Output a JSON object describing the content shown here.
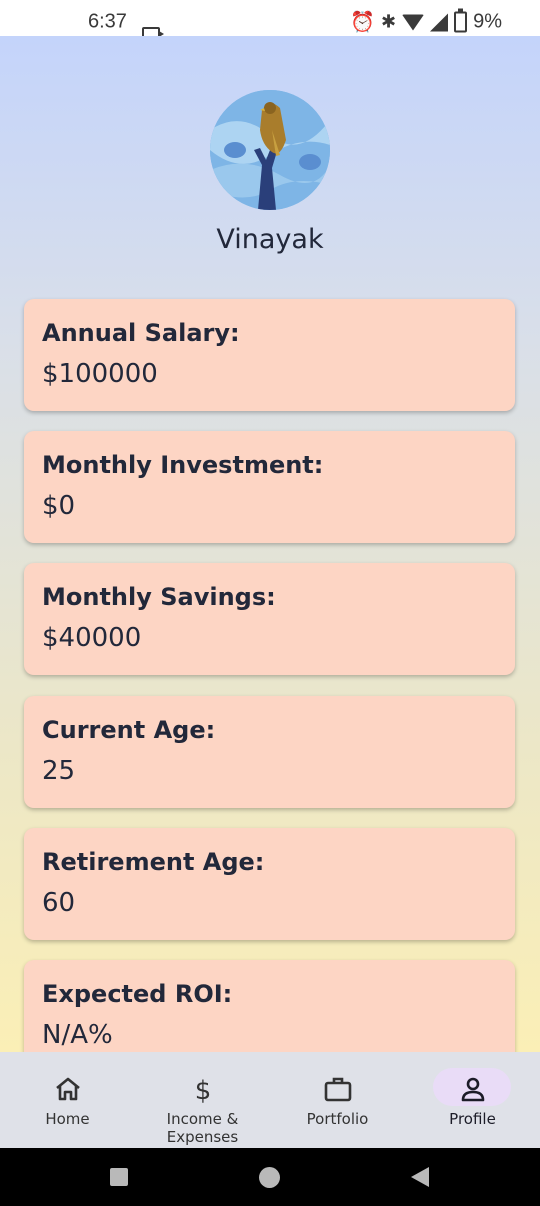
{
  "status_bar": {
    "time": "6:37",
    "battery_text": "9%",
    "icons": [
      "camera-icon",
      "alarm-icon",
      "bluetooth-icon",
      "wifi-icon",
      "signal-icon",
      "battery-icon"
    ]
  },
  "profile": {
    "avatar": "bird-on-branch-avatar",
    "name": "Vinayak"
  },
  "cards": [
    {
      "label": "Annual Salary:",
      "value": "$100000"
    },
    {
      "label": "Monthly Investment:",
      "value": "$0"
    },
    {
      "label": "Monthly Savings:",
      "value": "$40000"
    },
    {
      "label": "Current Age:",
      "value": "25"
    },
    {
      "label": "Retirement Age:",
      "value": "60"
    },
    {
      "label": "Expected ROI:",
      "value": "N/A%"
    }
  ],
  "bottom_nav": {
    "items": [
      {
        "label": "Home",
        "icon": "home-icon"
      },
      {
        "label": "Income & Expenses",
        "icon": "dollar-icon"
      },
      {
        "label": "Portfolio",
        "icon": "briefcase-icon"
      },
      {
        "label": "Profile",
        "icon": "person-icon",
        "active": true
      }
    ]
  },
  "colors": {
    "card_bg": "#fdd5c4",
    "gradient_top": "#c4d4fb",
    "gradient_bottom": "#fbefb6",
    "nav_active_pill": "#e9dcf7"
  }
}
